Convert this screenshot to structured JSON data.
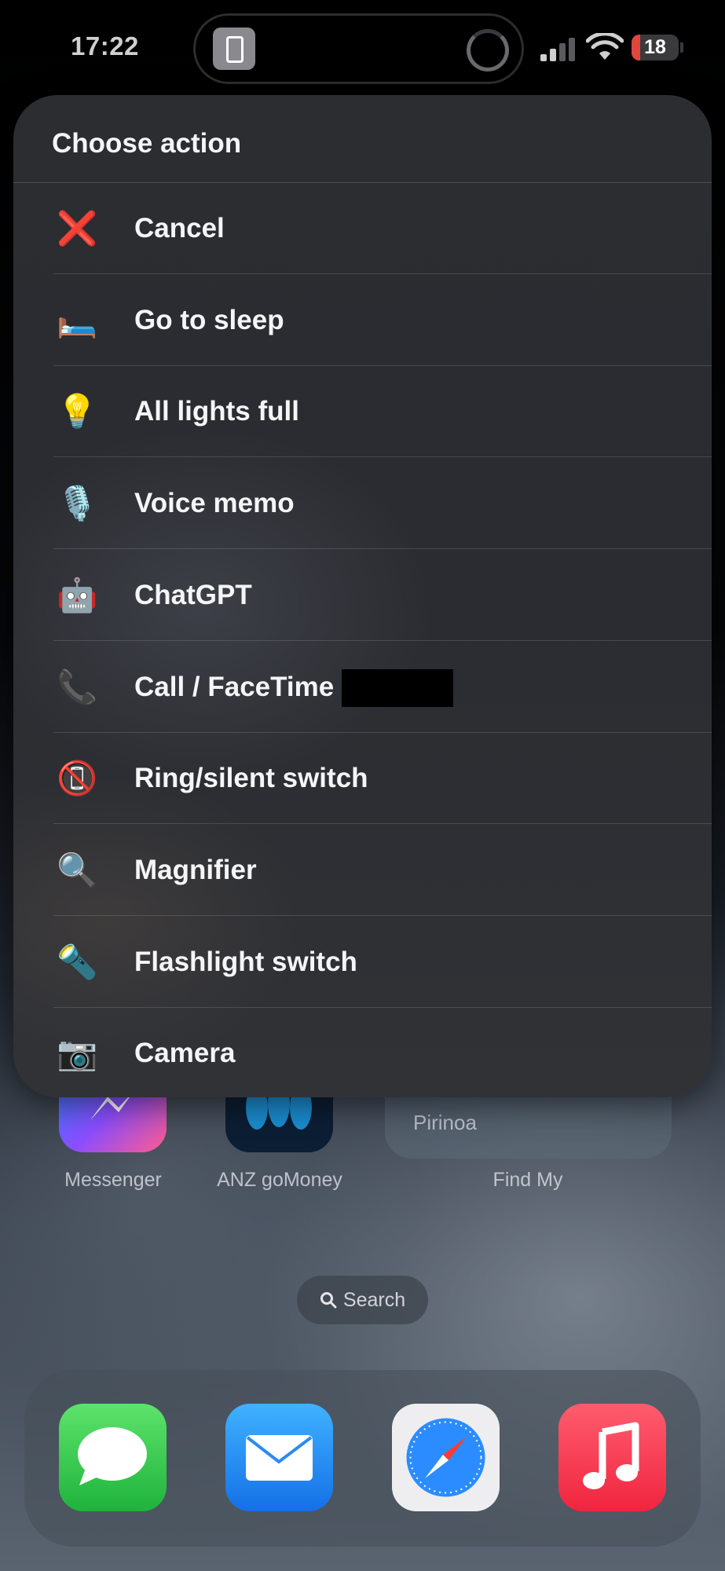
{
  "status_bar": {
    "time": "17:22",
    "battery": "18",
    "battery_level_percent": 18,
    "signal_bars_active": 2,
    "signal_bars_total": 4
  },
  "dynamic_island": {
    "app_icon": "phone-icon",
    "indicator": "progress-ring-icon"
  },
  "action_sheet": {
    "title": "Choose action",
    "items": [
      {
        "label": "Cancel",
        "icon": "cross-mark-icon",
        "glyph": "❌",
        "color": "#ff3b30"
      },
      {
        "label": "Go to sleep",
        "icon": "bed-icon",
        "glyph": "🛏️"
      },
      {
        "label": "All lights full",
        "icon": "light-bulb-icon",
        "glyph": "💡"
      },
      {
        "label": "Voice memo",
        "icon": "microphone-icon",
        "glyph": "🎙️"
      },
      {
        "label": "ChatGPT",
        "icon": "robot-icon",
        "glyph": "🤖"
      },
      {
        "label": "Call / FaceTime",
        "icon": "telephone-receiver-icon",
        "glyph": "📞",
        "redacted": true
      },
      {
        "label": "Ring/silent switch",
        "icon": "no-mobile-phones-icon",
        "glyph": "📵"
      },
      {
        "label": "Magnifier",
        "icon": "magnifying-glass-icon",
        "glyph": "🔍"
      },
      {
        "label": "Flashlight switch",
        "icon": "flashlight-icon",
        "glyph": "🔦"
      },
      {
        "label": "Camera",
        "icon": "camera-icon",
        "glyph": "📷"
      }
    ]
  },
  "home_screen": {
    "apps": [
      {
        "label": "Messenger",
        "icon": "messenger-icon"
      },
      {
        "label": "ANZ goMoney",
        "icon": "anz-gomoney-icon"
      }
    ],
    "find_my_widget": {
      "label": "Find My",
      "place": "Pirinoa"
    },
    "search": {
      "label": "Search",
      "icon": "search-icon"
    },
    "dock": [
      {
        "name": "Messages",
        "icon": "messages-icon",
        "color": "#34c759"
      },
      {
        "name": "Mail",
        "icon": "mail-icon",
        "color": "#1f8fff"
      },
      {
        "name": "Safari",
        "icon": "safari-compass-icon",
        "color": "#e8e8ea"
      },
      {
        "name": "Music",
        "icon": "music-note-icon",
        "color": "#fa3c55"
      }
    ]
  },
  "colors": {
    "sheet_background": "#2b2d31",
    "divider": "#48494d",
    "text": "#f5f5f7",
    "battery_low": "#e0463c"
  }
}
